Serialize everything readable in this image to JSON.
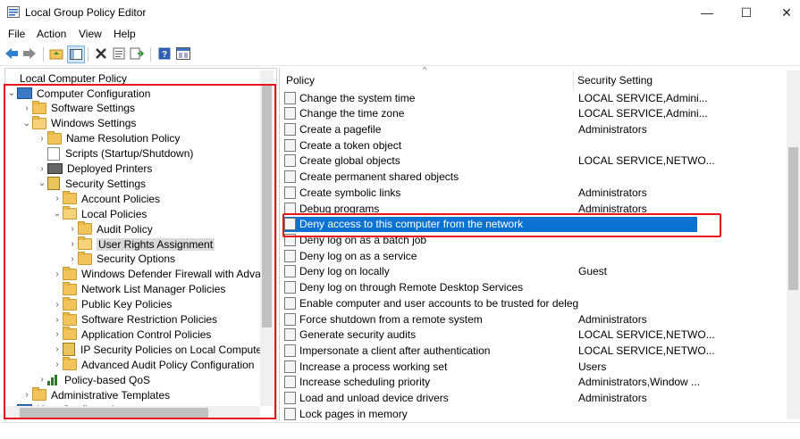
{
  "window": {
    "title": "Local Group Policy Editor",
    "minimize": "—",
    "maximize": "☐",
    "close": "✕"
  },
  "menu": [
    "File",
    "Action",
    "View",
    "Help"
  ],
  "toolbar": {
    "icons": [
      "back-arrow-icon",
      "forward-arrow-icon",
      "up-folder-icon",
      "show-hide-tree-icon",
      "delete-icon",
      "properties-icon",
      "export-list-icon",
      "help-icon",
      "console-icon"
    ]
  },
  "tree": {
    "root": "Local Computer Policy",
    "items": [
      {
        "label": "Computer Configuration",
        "icon": "computer",
        "chevron": "⌄"
      },
      {
        "label": "Software Settings",
        "icon": "folder",
        "chevron": "›"
      },
      {
        "label": "Windows Settings",
        "icon": "folder-open",
        "chevron": "⌄"
      },
      {
        "label": "Name Resolution Policy",
        "icon": "folder",
        "chevron": "›"
      },
      {
        "label": "Scripts (Startup/Shutdown)",
        "icon": "doc",
        "chevron": ""
      },
      {
        "label": "Deployed Printers",
        "icon": "printer",
        "chevron": "›"
      },
      {
        "label": "Security Settings",
        "icon": "lock",
        "chevron": "⌄"
      },
      {
        "label": "Account Policies",
        "icon": "folder",
        "chevron": "›"
      },
      {
        "label": "Local Policies",
        "icon": "folder-open",
        "chevron": "⌄"
      },
      {
        "label": "Audit Policy",
        "icon": "folder",
        "chevron": "›"
      },
      {
        "label": "User Rights Assignment",
        "icon": "folder-open",
        "chevron": "›",
        "selected": true
      },
      {
        "label": "Security Options",
        "icon": "folder",
        "chevron": "›"
      },
      {
        "label": "Windows Defender Firewall with Advanc",
        "icon": "folder",
        "chevron": "›"
      },
      {
        "label": "Network List Manager Policies",
        "icon": "folder",
        "chevron": ""
      },
      {
        "label": "Public Key Policies",
        "icon": "folder",
        "chevron": "›"
      },
      {
        "label": "Software Restriction Policies",
        "icon": "folder",
        "chevron": "›"
      },
      {
        "label": "Application Control Policies",
        "icon": "folder",
        "chevron": "›"
      },
      {
        "label": "IP Security Policies on Local Computer",
        "icon": "lock",
        "chevron": "›"
      },
      {
        "label": "Advanced Audit Policy Configuration",
        "icon": "folder",
        "chevron": "›"
      },
      {
        "label": "Policy-based QoS",
        "icon": "chart",
        "chevron": "›"
      },
      {
        "label": "Administrative Templates",
        "icon": "folder",
        "chevron": "›"
      },
      {
        "label": "User Configuration",
        "icon": "computer",
        "chevron": "⌄"
      }
    ]
  },
  "columns": {
    "policy": "Policy",
    "setting": "Security Setting"
  },
  "policies": [
    {
      "name": "Change the system time",
      "setting": "LOCAL SERVICE,Admini..."
    },
    {
      "name": "Change the time zone",
      "setting": "LOCAL SERVICE,Admini..."
    },
    {
      "name": "Create a pagefile",
      "setting": "Administrators"
    },
    {
      "name": "Create a token object",
      "setting": ""
    },
    {
      "name": "Create global objects",
      "setting": "LOCAL SERVICE,NETWO..."
    },
    {
      "name": "Create permanent shared objects",
      "setting": ""
    },
    {
      "name": "Create symbolic links",
      "setting": "Administrators"
    },
    {
      "name": "Debug programs",
      "setting": "Administrators"
    },
    {
      "name": "Deny access to this computer from the network",
      "setting": "",
      "selected": true
    },
    {
      "name": "Deny log on as a batch job",
      "setting": ""
    },
    {
      "name": "Deny log on as a service",
      "setting": ""
    },
    {
      "name": "Deny log on locally",
      "setting": "Guest"
    },
    {
      "name": "Deny log on through Remote Desktop Services",
      "setting": ""
    },
    {
      "name": "Enable computer and user accounts to be trusted for delega...",
      "setting": ""
    },
    {
      "name": "Force shutdown from a remote system",
      "setting": "Administrators"
    },
    {
      "name": "Generate security audits",
      "setting": "LOCAL SERVICE,NETWO..."
    },
    {
      "name": "Impersonate a client after authentication",
      "setting": "LOCAL SERVICE,NETWO..."
    },
    {
      "name": "Increase a process working set",
      "setting": "Users"
    },
    {
      "name": "Increase scheduling priority",
      "setting": "Administrators,Window ..."
    },
    {
      "name": "Load and unload device drivers",
      "setting": "Administrators"
    },
    {
      "name": "Lock pages in memory",
      "setting": ""
    }
  ],
  "colors": {
    "selection": "#0a73d2",
    "highlight_box": "#e8141b"
  }
}
